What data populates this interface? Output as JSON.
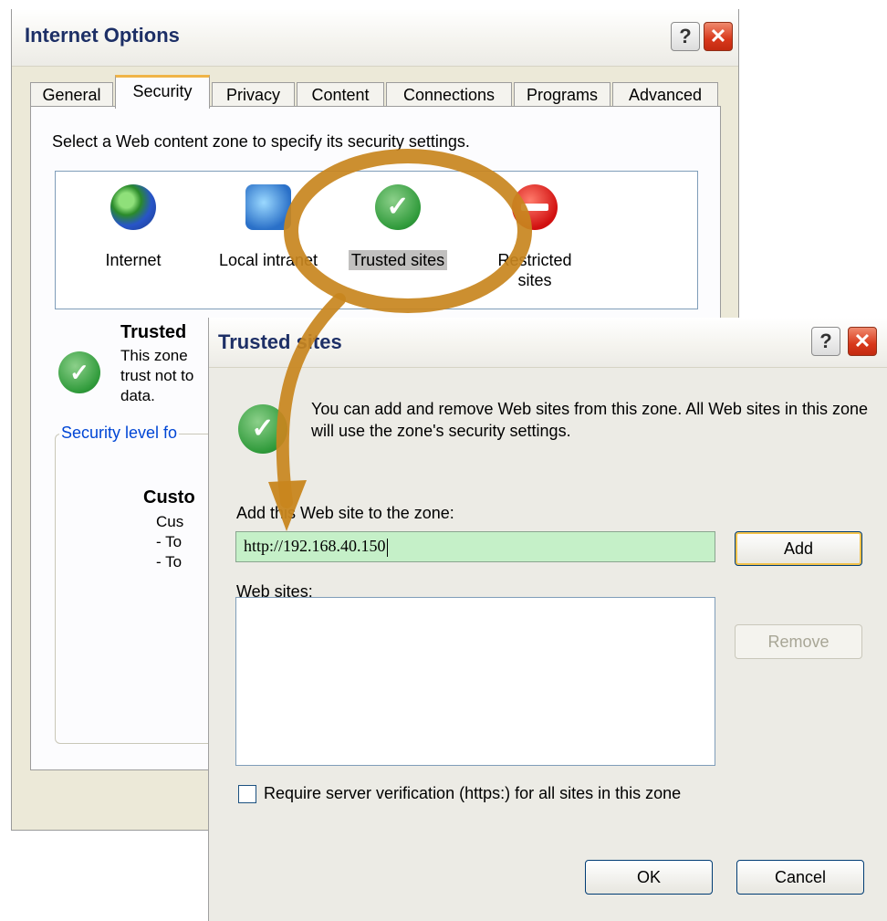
{
  "internet_options": {
    "title": "Internet Options",
    "help_glyph": "?",
    "close_glyph": "✕",
    "tabs": [
      {
        "label": "General"
      },
      {
        "label": "Security",
        "active": true
      },
      {
        "label": "Privacy"
      },
      {
        "label": "Content"
      },
      {
        "label": "Connections"
      },
      {
        "label": "Programs"
      },
      {
        "label": "Advanced"
      }
    ],
    "zone_instruction": "Select a Web content zone to specify its security settings.",
    "zones": [
      {
        "label": "Internet",
        "icon": "globe-icon"
      },
      {
        "label": "Local intranet",
        "icon": "local-intranet-icon"
      },
      {
        "label": "Trusted sites",
        "icon": "trusted-check-icon",
        "selected": true
      },
      {
        "label": "Restricted sites",
        "icon": "restricted-icon"
      }
    ],
    "zone_description": {
      "title": "Trusted",
      "lines": [
        "This zone",
        "trust not to",
        "data."
      ]
    },
    "security_level_label": "Security level fo",
    "custom_title": "Custo",
    "custom_lines": [
      "Cus",
      "- To",
      "- To"
    ]
  },
  "trusted_sites": {
    "title": "Trusted sites",
    "help_glyph": "?",
    "close_glyph": "✕",
    "info": "You can add and remove Web sites from this zone. All Web sites in this zone will use the zone's security settings.",
    "add_label": "Add this Web site to the zone:",
    "input_value": "http://192.168.40.150",
    "add_button": "Add",
    "websites_label": "Web sites:",
    "websites": [],
    "remove_button": "Remove",
    "require_https_label": "Require server verification (https:) for all sites in this zone",
    "require_https_checked": false,
    "ok_button": "OK",
    "cancel_button": "Cancel"
  },
  "colors": {
    "annotation": "#c8861e",
    "dialog_bg": "#ecebe5",
    "input_highlight": "#c5f0c8",
    "title_text": "#1d2f66"
  }
}
